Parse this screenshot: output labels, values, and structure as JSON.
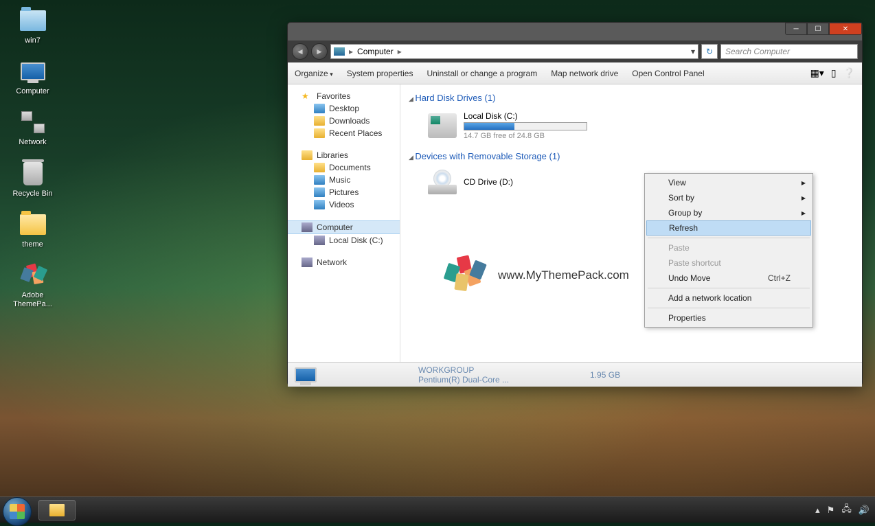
{
  "desktop": {
    "icons": [
      {
        "label": "win7"
      },
      {
        "label": "Computer"
      },
      {
        "label": "Network"
      },
      {
        "label": "Recycle Bin"
      },
      {
        "label": "theme"
      },
      {
        "label": "Adobe ThemePa..."
      }
    ]
  },
  "window": {
    "address": {
      "location": "Computer"
    },
    "search": {
      "placeholder": "Search Computer"
    },
    "toolbar": {
      "organize": "Organize",
      "sysprops": "System properties",
      "uninstall": "Uninstall or change a program",
      "mapdrive": "Map network drive",
      "ctrlpanel": "Open Control Panel"
    },
    "sidebar": {
      "favorites": {
        "title": "Favorites",
        "items": [
          "Desktop",
          "Downloads",
          "Recent Places"
        ]
      },
      "libraries": {
        "title": "Libraries",
        "items": [
          "Documents",
          "Music",
          "Pictures",
          "Videos"
        ]
      },
      "computer": {
        "title": "Computer",
        "items": [
          "Local Disk (C:)"
        ]
      },
      "network": {
        "title": "Network"
      }
    },
    "main": {
      "hdd": {
        "header": "Hard Disk Drives (1)",
        "name": "Local Disk (C:)",
        "sub": "14.7 GB free of 24.8 GB"
      },
      "removable": {
        "header": "Devices with Removable Storage (1)",
        "name": "CD Drive (D:)"
      },
      "watermark": "www.MyThemePack.com"
    },
    "status": {
      "workgroup": "WORKGROUP",
      "cpu": "Pentium(R) Dual-Core  ...",
      "ram": "1.95 GB"
    }
  },
  "context_menu": {
    "view": "View",
    "sortby": "Sort by",
    "groupby": "Group by",
    "refresh": "Refresh",
    "paste": "Paste",
    "paste_shortcut": "Paste shortcut",
    "undo": "Undo Move",
    "undo_key": "Ctrl+Z",
    "addnet": "Add a network location",
    "properties": "Properties"
  }
}
